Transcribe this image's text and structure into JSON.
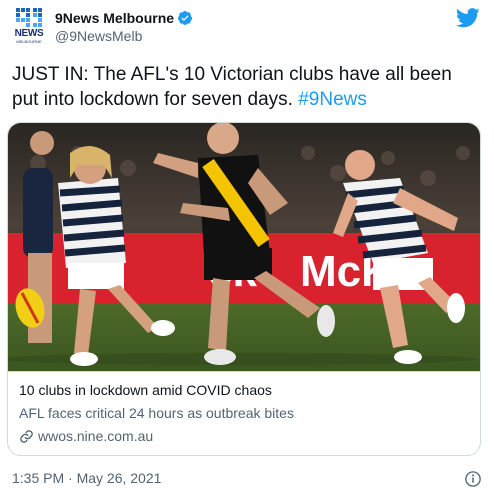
{
  "account": {
    "logo_text": "NEWS",
    "logo_tag": "MELBOURNE",
    "display_name": "9News Melbourne",
    "handle": "@9NewsMelb"
  },
  "tweet": {
    "text": "JUST IN: The AFL's 10 Victorian clubs have all been put into lockdown for seven days.",
    "hashtag": "#9News",
    "timestamp": "1:35 PM · May 26, 2021"
  },
  "card": {
    "image_sign_text": "McKe",
    "image_sign_prefix": "ck",
    "title": "10 clubs in lockdown amid COVID chaos",
    "description": "AFL faces critical 24 hours as outbreak bites",
    "domain": "wwos.nine.com.au"
  },
  "colors": {
    "link_blue": "#1d9bf0",
    "secondary_text": "#536471",
    "border": "#cfd9de",
    "nine_navy": "#1b2e6e"
  },
  "icons": [
    "nine-news-logo-icon",
    "verified-badge-icon",
    "twitter-bird-icon",
    "link-icon",
    "info-icon"
  ]
}
